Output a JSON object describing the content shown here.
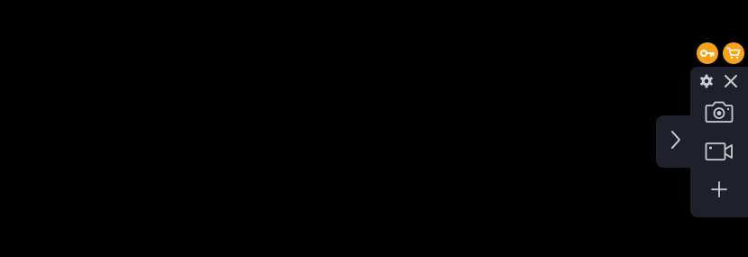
{
  "colors": {
    "background": "#000000",
    "panel": "#1e2129",
    "icon": "#c9ccd3",
    "accent": "#f7a21b",
    "accent_glyph": "#ffffff"
  },
  "badges": {
    "license_icon": "key-icon",
    "store_icon": "cart-icon"
  },
  "collapse_tab": {
    "icon": "chevron-right-icon"
  },
  "toolbar": {
    "settings_icon": "gear-icon",
    "close_icon": "close-icon",
    "items": [
      {
        "icon": "camera-icon"
      },
      {
        "icon": "video-camera-icon"
      },
      {
        "icon": "plus-icon"
      }
    ]
  }
}
